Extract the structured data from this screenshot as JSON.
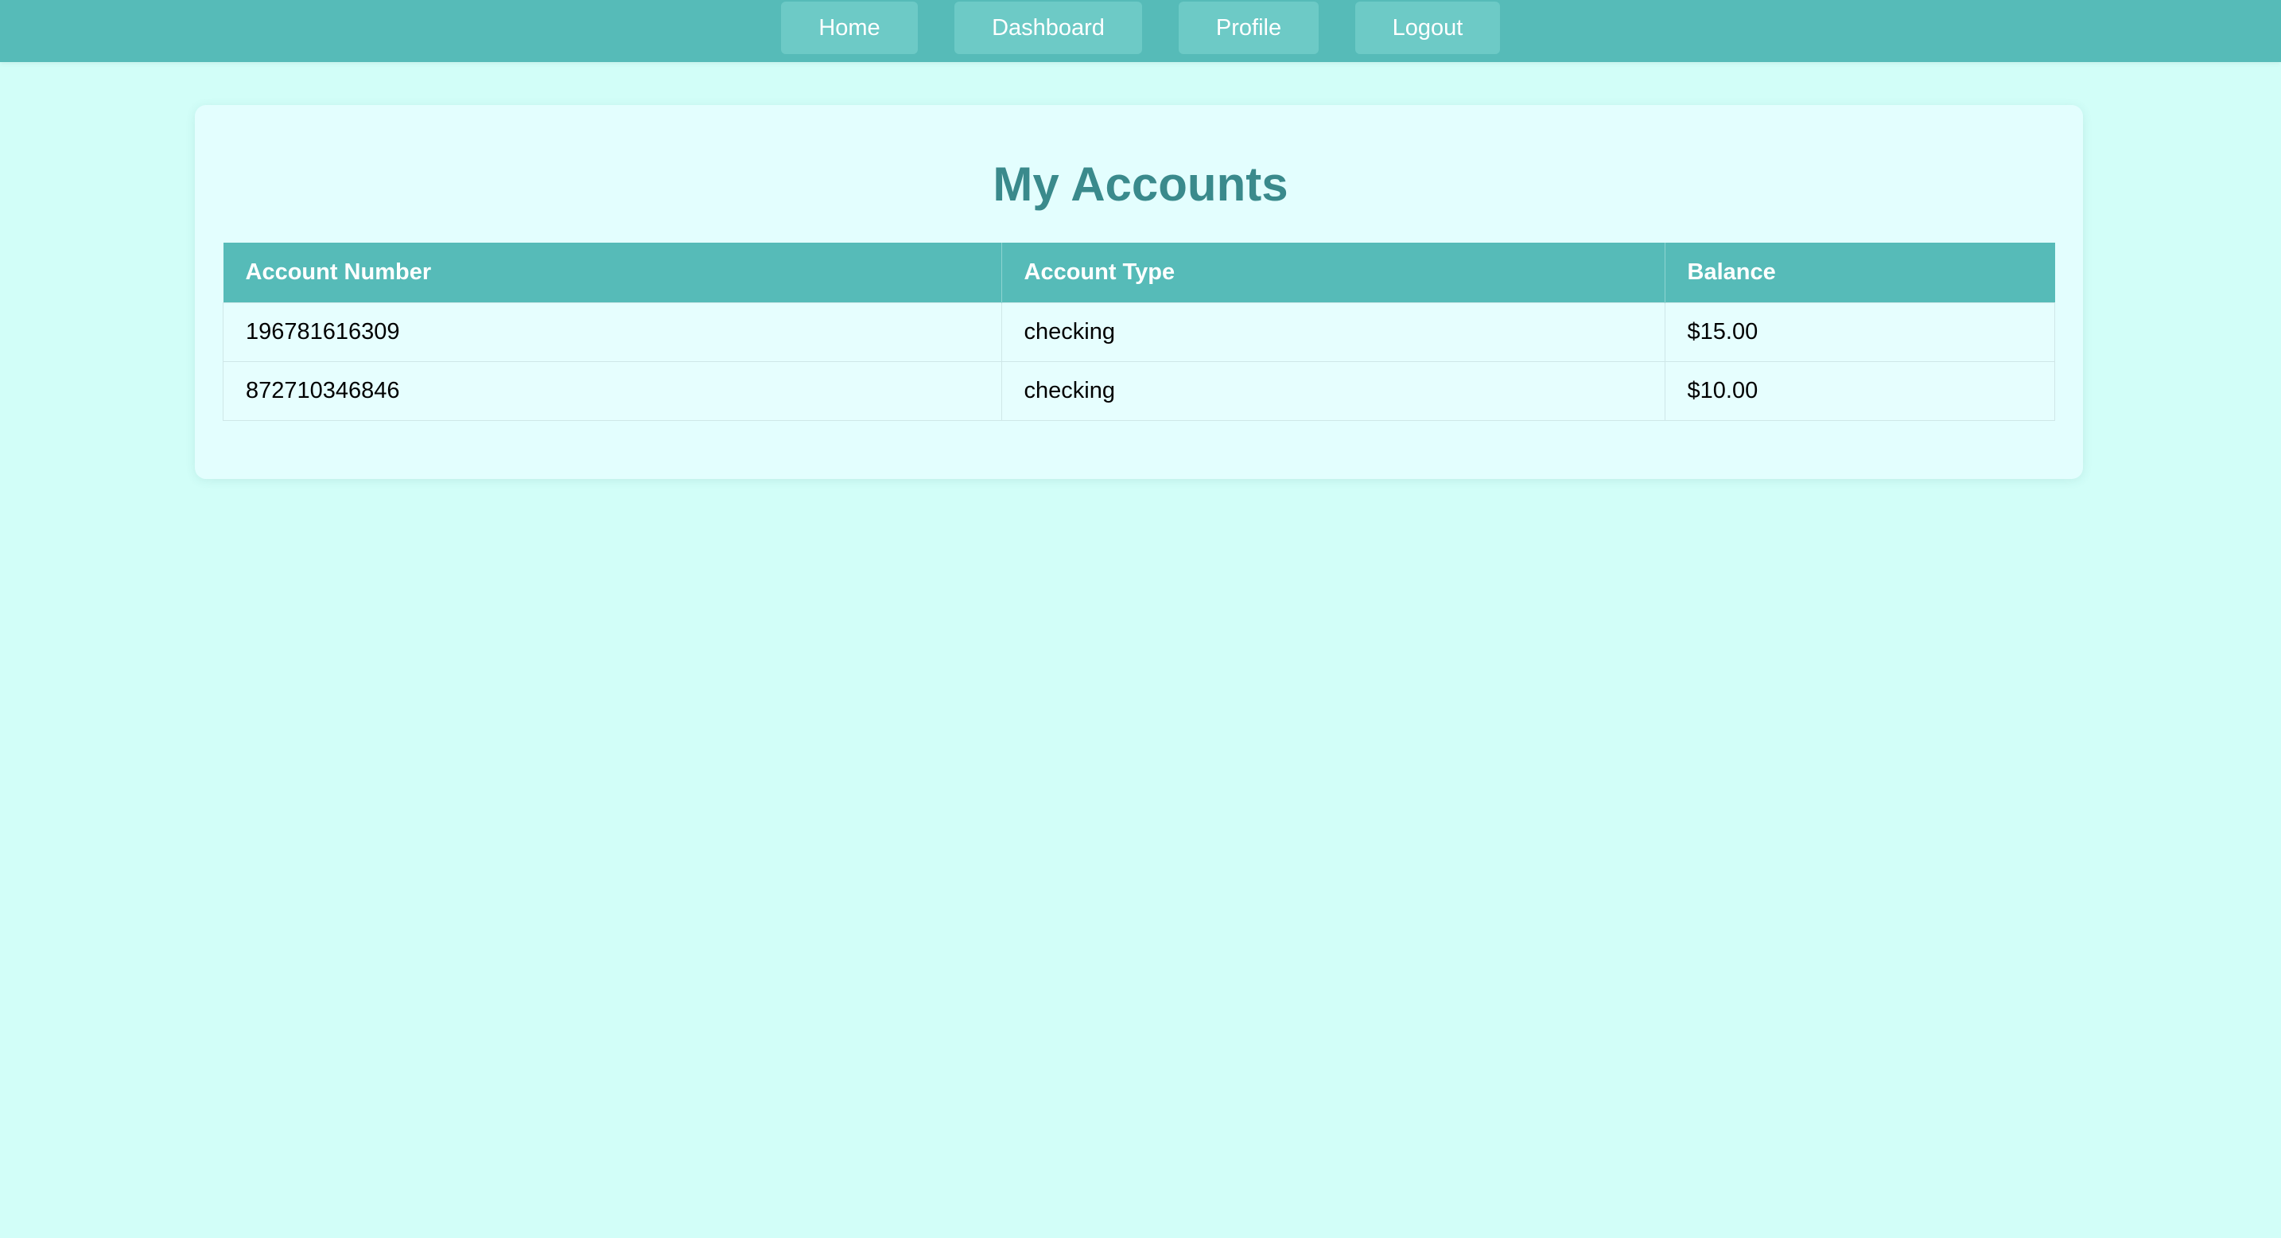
{
  "nav": {
    "home": "Home",
    "dashboard": "Dashboard",
    "profile": "Profile",
    "logout": "Logout"
  },
  "page": {
    "title": "My Accounts"
  },
  "table": {
    "headers": [
      "Account Number",
      "Account Type",
      "Balance"
    ],
    "rows": [
      {
        "account_number": "196781616309",
        "account_type": "checking",
        "balance": "$15.00"
      },
      {
        "account_number": "872710346846",
        "account_type": "checking",
        "balance": "$10.00"
      }
    ]
  },
  "colors": {
    "navbar": "#56bbb8",
    "nav_button": "#6dcac6",
    "page_background": "#d2fef8",
    "card_background": "#e3fefe",
    "title": "#3a8a8c",
    "table_header": "#56bbb8"
  }
}
